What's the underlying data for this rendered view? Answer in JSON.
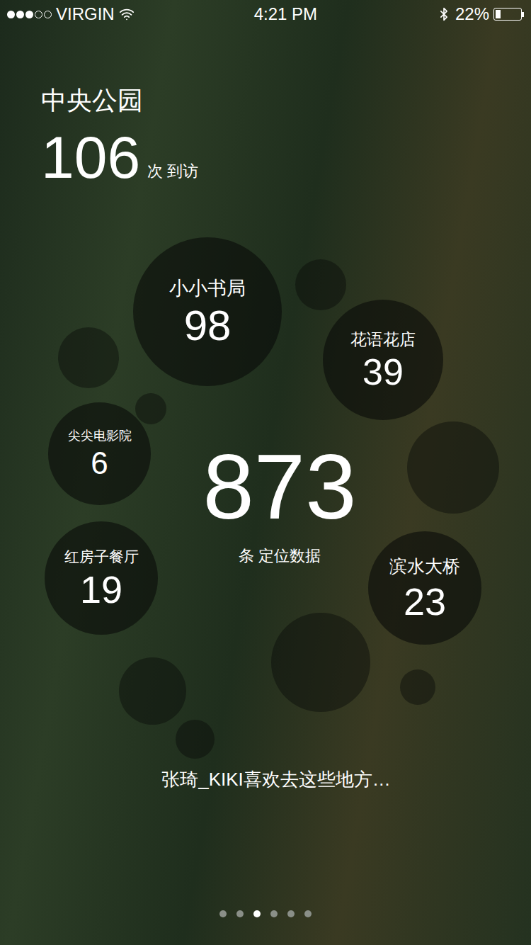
{
  "status_bar": {
    "carrier": "VIRGIN",
    "signal_level": 0.6,
    "time": "4:21 PM",
    "battery": "22%",
    "battery_level": 0.22
  },
  "header": {
    "place": "中央公园",
    "count": "106",
    "unit": "次 到访"
  },
  "places": [
    {
      "name": "小小书局",
      "count": "98"
    },
    {
      "name": "花语花店",
      "count": "39"
    },
    {
      "name": "尖尖电影院",
      "count": "6"
    },
    {
      "name": "红房子餐厅",
      "count": "19"
    },
    {
      "name": "滨水大桥",
      "count": "23"
    }
  ],
  "total": {
    "count": "873",
    "unit": "条 定位数据"
  },
  "caption": "张琦_KIKI喜欢去这些地方…",
  "pager": [
    {
      "selected": false
    },
    {
      "selected": false
    },
    {
      "selected": true
    },
    {
      "selected": false
    },
    {
      "selected": false
    },
    {
      "selected": false
    }
  ]
}
